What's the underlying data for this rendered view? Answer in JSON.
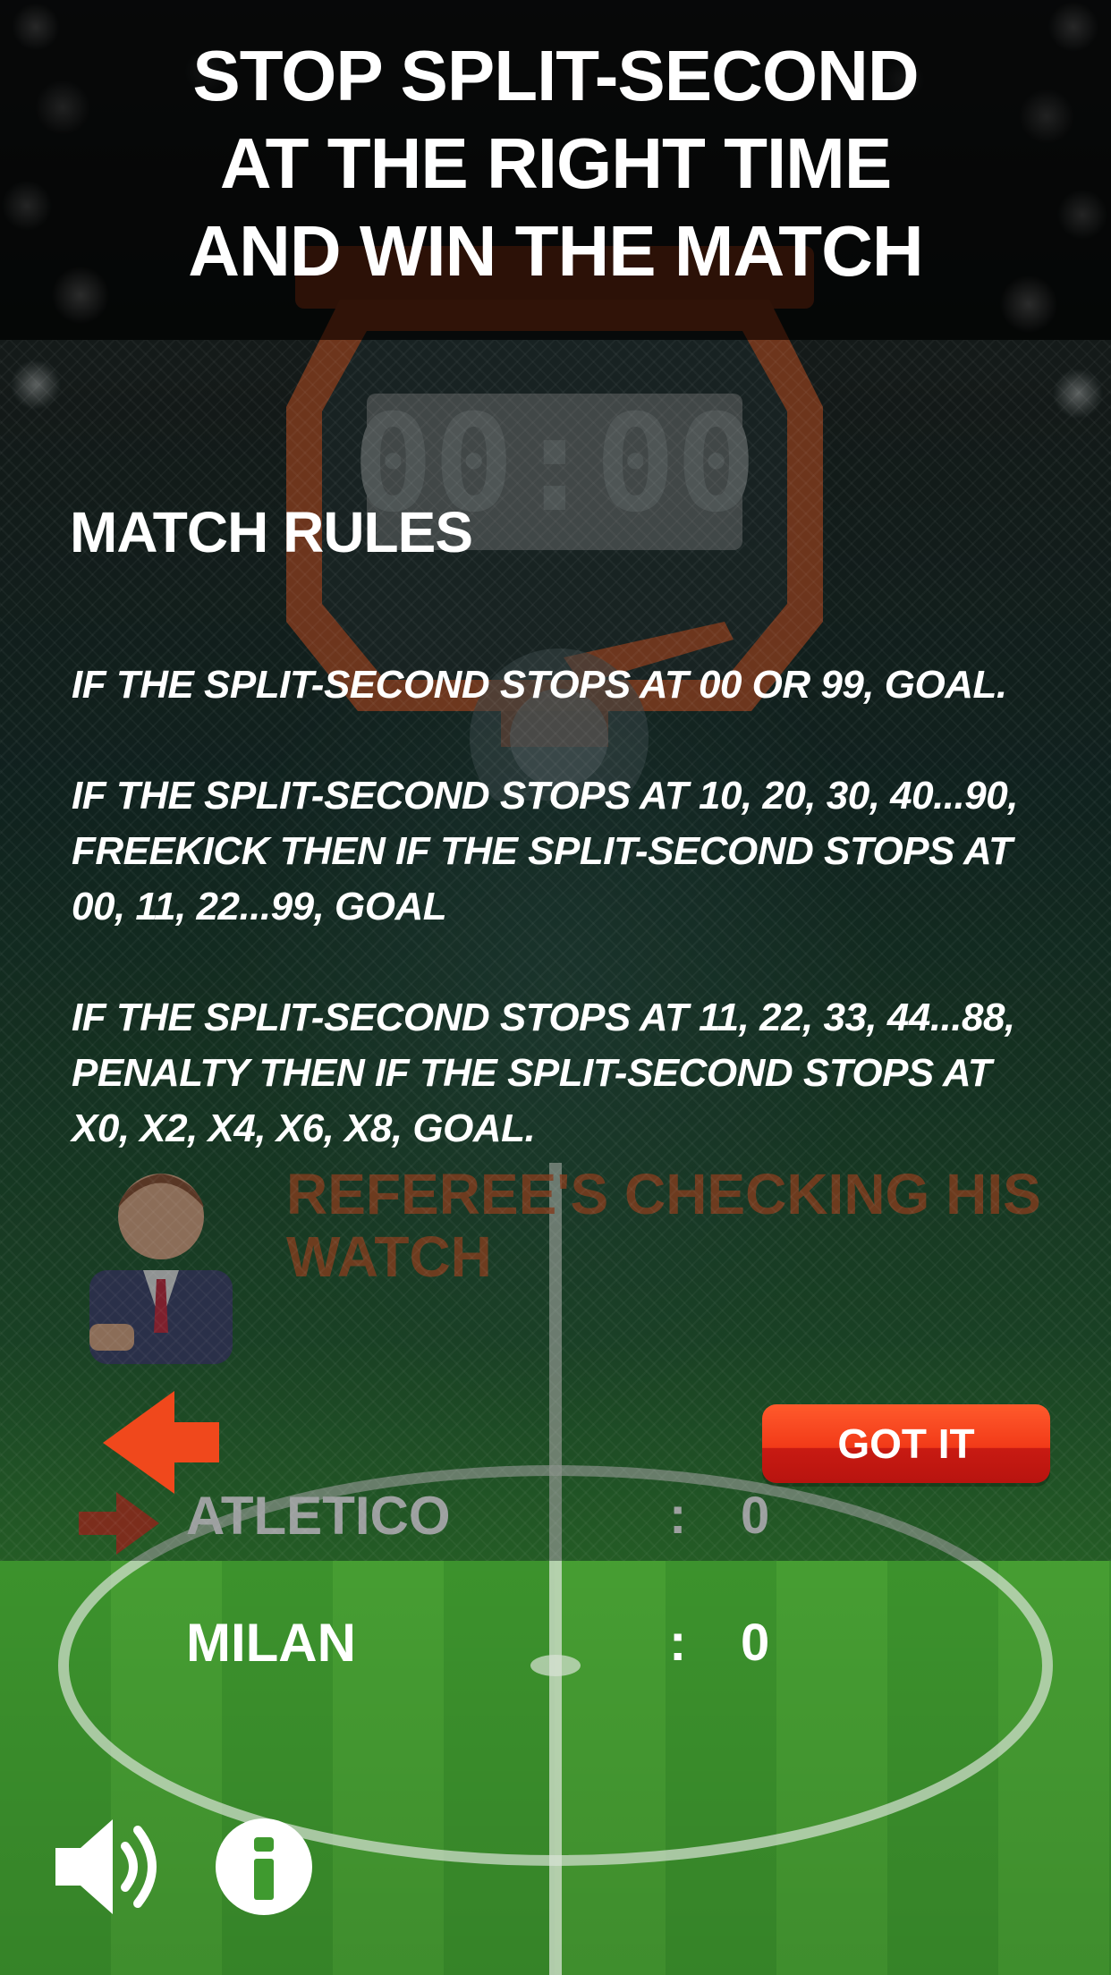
{
  "banner": {
    "title": "STOP SPLIT-SECOND\nAT THE RIGHT TIME\nAND WIN THE MATCH"
  },
  "game": {
    "timer": "00:00",
    "referee_status": "REFEREE'S CHECKING HIS\nWATCH",
    "scoreboard": [
      {
        "team": "ATLETICO",
        "separator": ":",
        "score": "0"
      },
      {
        "team": "MILAN",
        "separator": ":",
        "score": "0"
      }
    ]
  },
  "rules_overlay": {
    "title": "MATCH RULES",
    "rules": [
      "IF THE SPLIT-SECOND STOPS AT 00 OR 99, GOAL.",
      "IF THE SPLIT-SECOND STOPS AT 10, 20, 30, 40...90, FREEKICK THEN IF THE SPLIT-SECOND STOPS AT 00, 11, 22...99, GOAL",
      "IF THE SPLIT-SECOND STOPS AT 11, 22, 33, 44...88, PENALTY THEN IF THE SPLIT-SECOND STOPS AT X0, X2, X4, X6, X8, GOAL."
    ],
    "confirm_label": "GOT IT"
  },
  "icons": {
    "back": "back-arrow-icon",
    "turn_indicator": "arrow-right-icon",
    "sound": "speaker-icon",
    "info": "info-icon"
  },
  "colors": {
    "accent_orange": "#f0481c",
    "button_red": "#e8301a",
    "watch_orange": "#c9501f",
    "pitch_green": "#3f9a2f"
  }
}
